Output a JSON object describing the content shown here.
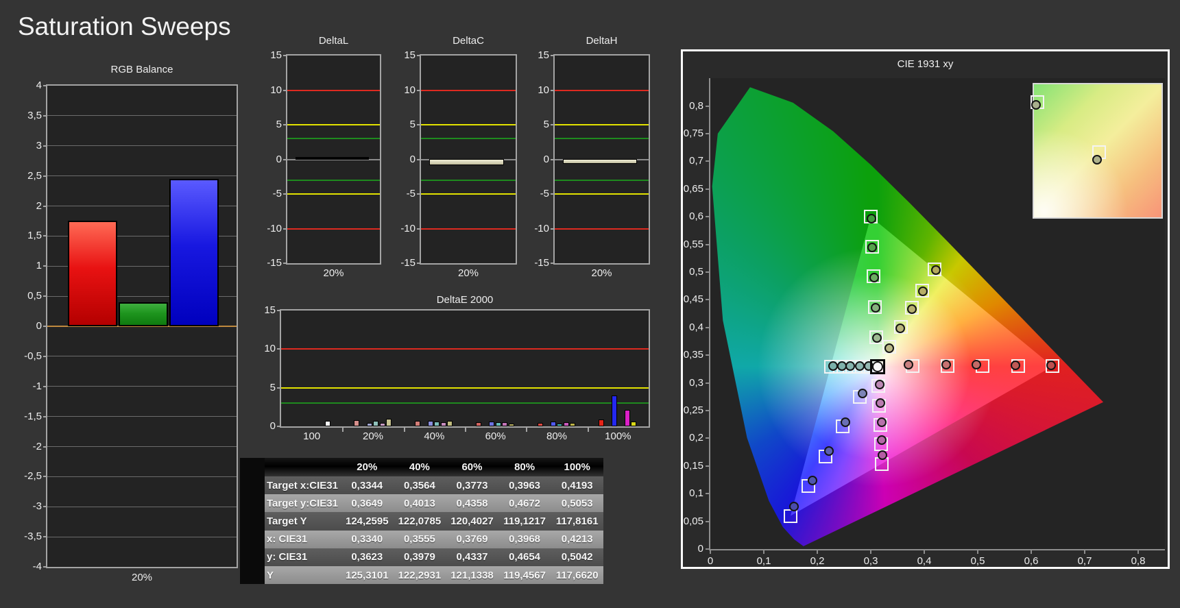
{
  "page": {
    "title": "Saturation Sweeps"
  },
  "colors": {
    "limit_red": "#DE2A20",
    "limit_yellow": "#E2E200",
    "limit_green": "#1E8A1E",
    "zero_orange": "#C08A3E",
    "zero_gray": "#8C8C8C",
    "white_bar": "#F4F4F4"
  },
  "chart_data": [
    {
      "id": "rgb_balance",
      "type": "bar",
      "title": "RGB Balance",
      "xlabel": "20%",
      "categories": [
        "Red",
        "Green",
        "Blue"
      ],
      "values": [
        1.75,
        0.4,
        2.45
      ],
      "ylim": [
        -4,
        4
      ],
      "ytick_step": 0.5,
      "grid": true,
      "bar_gradients": [
        [
          "#FF6A55",
          "#E81212",
          "#B40000"
        ],
        [
          "#3FAF3F",
          "#1E951E",
          "#0F7A0F"
        ],
        [
          "#5A5AFF",
          "#1818E0",
          "#0000BE"
        ]
      ]
    },
    {
      "id": "deltaL",
      "type": "bar",
      "title": "DeltaL",
      "xlabel": "20%",
      "categories": [
        "20%"
      ],
      "values": [
        0.3
      ],
      "ylim": [
        -15,
        15
      ],
      "yticks": [
        15,
        10,
        5,
        0,
        -5,
        -10,
        -15
      ],
      "limits": {
        "red": 10,
        "yellow": 5,
        "green": 3
      },
      "bar_color_top": "#0A0A0A",
      "bar_color_bottom": "#000000"
    },
    {
      "id": "deltaC",
      "type": "bar",
      "title": "DeltaC",
      "xlabel": "20%",
      "categories": [
        "20%"
      ],
      "values": [
        -0.95
      ],
      "ylim": [
        -15,
        15
      ],
      "yticks": [
        15,
        10,
        5,
        0,
        -5,
        -10,
        -15
      ],
      "limits": {
        "red": 10,
        "yellow": 5,
        "green": 3
      },
      "bar_color_top": "#EFEDD6",
      "bar_color_bottom": "#C2BE9E"
    },
    {
      "id": "deltaH",
      "type": "bar",
      "title": "DeltaH",
      "xlabel": "20%",
      "categories": [
        "20%"
      ],
      "values": [
        -0.7
      ],
      "ylim": [
        -15,
        15
      ],
      "yticks": [
        15,
        10,
        5,
        0,
        -5,
        -10,
        -15
      ],
      "limits": {
        "red": 10,
        "yellow": 5,
        "green": 3
      },
      "bar_color_top": "#EFEDD6",
      "bar_color_bottom": "#C2BE9E"
    },
    {
      "id": "deltaE2000",
      "type": "grouped-bar",
      "title": "DeltaE 2000",
      "ylim": [
        0,
        15
      ],
      "yticks": [
        0,
        5,
        10,
        15
      ],
      "limits": {
        "red": 10,
        "yellow": 5,
        "green": 3
      },
      "groups": [
        {
          "label": "100",
          "bars": [
            {
              "slot": 5,
              "value": 0.7,
              "color": "#F4F4F4"
            }
          ]
        },
        {
          "label": "20%",
          "bars": [
            {
              "slot": 0,
              "value": 0.8,
              "color": "#D6908C"
            },
            {
              "slot": 2,
              "value": 0.45,
              "color": "#A2A8D2"
            },
            {
              "slot": 3,
              "value": 0.75,
              "color": "#8FC0BA"
            },
            {
              "slot": 4,
              "value": 0.45,
              "color": "#C89CC2"
            },
            {
              "slot": 5,
              "value": 0.95,
              "color": "#C6C290"
            }
          ]
        },
        {
          "label": "40%",
          "bars": [
            {
              "slot": 0,
              "value": 0.75,
              "color": "#D47E78"
            },
            {
              "slot": 2,
              "value": 0.7,
              "color": "#8A8EDC"
            },
            {
              "slot": 3,
              "value": 0.65,
              "color": "#7CBEB8"
            },
            {
              "slot": 4,
              "value": 0.5,
              "color": "#C68CBE"
            },
            {
              "slot": 5,
              "value": 0.7,
              "color": "#C0BC7E"
            }
          ]
        },
        {
          "label": "60%",
          "bars": [
            {
              "slot": 0,
              "value": 0.55,
              "color": "#D26460"
            },
            {
              "slot": 2,
              "value": 0.6,
              "color": "#6C72E2"
            },
            {
              "slot": 3,
              "value": 0.5,
              "color": "#64BCB6"
            },
            {
              "slot": 4,
              "value": 0.5,
              "color": "#C474B8"
            },
            {
              "slot": 5,
              "value": 0.35,
              "color": "#BCB464"
            }
          ]
        },
        {
          "label": "80%",
          "bars": [
            {
              "slot": 0,
              "value": 0.45,
              "color": "#DA4840"
            },
            {
              "slot": 2,
              "value": 0.6,
              "color": "#5058EC"
            },
            {
              "slot": 3,
              "value": 0.35,
              "color": "#48BCB6"
            },
            {
              "slot": 4,
              "value": 0.5,
              "color": "#CA58BC"
            },
            {
              "slot": 5,
              "value": 0.4,
              "color": "#BCB448"
            }
          ]
        },
        {
          "label": "100%",
          "bars": [
            {
              "slot": 0,
              "value": 0.9,
              "color": "#E62418"
            },
            {
              "slot": 2,
              "value": 4.0,
              "color": "#2428F0"
            },
            {
              "slot": 4,
              "value": 2.1,
              "color": "#DC20C8"
            },
            {
              "slot": 5,
              "value": 0.65,
              "color": "#D8D818"
            }
          ]
        }
      ]
    },
    {
      "id": "sweep_table",
      "type": "table",
      "columns": [
        "20%",
        "40%",
        "60%",
        "80%",
        "100%"
      ],
      "rows": [
        {
          "label": "Target x:CIE31",
          "values": [
            "0,3344",
            "0,3564",
            "0,3773",
            "0,3963",
            "0,4193"
          ]
        },
        {
          "label": "Target y:CIE31",
          "values": [
            "0,3649",
            "0,4013",
            "0,4358",
            "0,4672",
            "0,5053"
          ]
        },
        {
          "label": "Target Y",
          "values": [
            "124,2595",
            "122,0785",
            "120,4027",
            "119,1217",
            "117,8161"
          ]
        },
        {
          "label": "x: CIE31",
          "values": [
            "0,3340",
            "0,3555",
            "0,3769",
            "0,3968",
            "0,4213"
          ]
        },
        {
          "label": "y: CIE31",
          "values": [
            "0,3623",
            "0,3979",
            "0,4337",
            "0,4654",
            "0,5042"
          ]
        },
        {
          "label": "Y",
          "values": [
            "125,3101",
            "122,2931",
            "121,1338",
            "119,4567",
            "117,6620"
          ]
        }
      ]
    },
    {
      "id": "cie1931",
      "type": "scatter",
      "title": "CIE 1931 xy",
      "xlim": [
        0,
        0.85
      ],
      "ylim": [
        0,
        0.85
      ],
      "xtick_step": 0.1,
      "ytick_step": 0.05,
      "locus": [
        [
          0.1741,
          0.005
        ],
        [
          0.1566,
          0.0177
        ],
        [
          0.1355,
          0.0399
        ],
        [
          0.1096,
          0.0868
        ],
        [
          0.0687,
          0.2007
        ],
        [
          0.0235,
          0.4127
        ],
        [
          0.0034,
          0.6548
        ],
        [
          0.0139,
          0.7502
        ],
        [
          0.0743,
          0.8338
        ],
        [
          0.1547,
          0.8059
        ],
        [
          0.2296,
          0.7543
        ],
        [
          0.3016,
          0.6923
        ],
        [
          0.3731,
          0.6245
        ],
        [
          0.4441,
          0.5547
        ],
        [
          0.5125,
          0.4866
        ],
        [
          0.5752,
          0.4242
        ],
        [
          0.627,
          0.3725
        ],
        [
          0.6658,
          0.334
        ],
        [
          0.6915,
          0.3083
        ],
        [
          0.719,
          0.2809
        ],
        [
          0.7347,
          0.2653
        ]
      ],
      "triangle": {
        "red": [
          0.64,
          0.33
        ],
        "green": [
          0.3,
          0.6
        ],
        "blue": [
          0.15,
          0.06
        ]
      },
      "white_point": {
        "target": [
          0.3127,
          0.329
        ],
        "measured": [
          0.3127,
          0.3295
        ],
        "dot_color": "#F8F8F8"
      },
      "sweeps": [
        {
          "name": "red",
          "targets": [
            [
              0.378,
              0.331
            ],
            [
              0.444,
              0.331
            ],
            [
              0.509,
              0.33
            ],
            [
              0.575,
              0.33
            ],
            [
              0.64,
              0.33
            ]
          ],
          "measured": [
            [
              0.37,
              0.333
            ],
            [
              0.441,
              0.333
            ],
            [
              0.497,
              0.333
            ],
            [
              0.571,
              0.332
            ],
            [
              0.637,
              0.332
            ]
          ],
          "dot_colors": [
            "#C98080",
            "#C97272",
            "#C46A66",
            "#C05A56",
            "#BE5050"
          ]
        },
        {
          "name": "green",
          "targets": [
            [
              0.31,
              0.383
            ],
            [
              0.308,
              0.437
            ],
            [
              0.305,
              0.492
            ],
            [
              0.303,
              0.546
            ],
            [
              0.3,
              0.6
            ]
          ],
          "measured": [
            [
              0.311,
              0.381
            ],
            [
              0.309,
              0.436
            ],
            [
              0.306,
              0.49
            ],
            [
              0.303,
              0.544
            ],
            [
              0.301,
              0.597
            ]
          ],
          "dot_colors": [
            "#9DBA92",
            "#85B27C",
            "#6CAC60",
            "#55A24C",
            "#3F9E3C"
          ]
        },
        {
          "name": "blue",
          "targets": [
            [
              0.28,
              0.275
            ],
            [
              0.248,
              0.221
            ],
            [
              0.215,
              0.167
            ],
            [
              0.183,
              0.114
            ],
            [
              0.15,
              0.06
            ]
          ],
          "measured": [
            [
              0.284,
              0.281
            ],
            [
              0.253,
              0.229
            ],
            [
              0.222,
              0.177
            ],
            [
              0.191,
              0.124
            ],
            [
              0.157,
              0.077
            ]
          ],
          "dot_colors": [
            "#7C84B6",
            "#6A6FB4",
            "#5C60B2",
            "#5056AE",
            "#4A4CAC"
          ]
        },
        {
          "name": "cyan",
          "targets": [
            [
              0.295,
              0.329
            ],
            [
              0.277,
              0.329
            ],
            [
              0.26,
              0.329
            ],
            [
              0.242,
              0.329
            ],
            [
              0.225,
              0.329
            ]
          ],
          "measured": [
            [
              0.296,
              0.33
            ],
            [
              0.279,
              0.331
            ],
            [
              0.262,
              0.331
            ],
            [
              0.246,
              0.331
            ],
            [
              0.229,
              0.331
            ]
          ],
          "dot_colors": [
            "#95B8B2",
            "#8CB6B0",
            "#86B4AE",
            "#80B2AC",
            "#7AB0AA"
          ]
        },
        {
          "name": "magenta",
          "targets": [
            [
              0.314,
              0.294
            ],
            [
              0.316,
              0.259
            ],
            [
              0.318,
              0.224
            ],
            [
              0.319,
              0.189
            ],
            [
              0.321,
              0.154
            ]
          ],
          "measured": [
            [
              0.317,
              0.297
            ],
            [
              0.318,
              0.263
            ],
            [
              0.32,
              0.229
            ],
            [
              0.321,
              0.197
            ],
            [
              0.322,
              0.17
            ]
          ],
          "dot_colors": [
            "#BC88B4",
            "#BA7CB0",
            "#B871AC",
            "#B667A8",
            "#B45CA4"
          ]
        },
        {
          "name": "yellow",
          "targets": [
            [
              0.3344,
              0.3649
            ],
            [
              0.3564,
              0.4013
            ],
            [
              0.3773,
              0.4358
            ],
            [
              0.3963,
              0.4672
            ],
            [
              0.4193,
              0.5053
            ]
          ],
          "measured": [
            [
              0.334,
              0.3623
            ],
            [
              0.3555,
              0.3979
            ],
            [
              0.3769,
              0.4337
            ],
            [
              0.3968,
              0.4654
            ],
            [
              0.4213,
              0.5042
            ]
          ],
          "dot_colors": [
            "#BCBA88",
            "#BAB67C",
            "#B8B270",
            "#B6AE66",
            "#B4AA5C"
          ]
        }
      ],
      "inset": {
        "markers": [
          {
            "square": [
              5,
              26
            ],
            "circle": [
              3,
              30
            ],
            "dot_color": "#A8AE8C"
          },
          {
            "square": [
              95,
              99
            ],
            "circle": [
              92,
              110
            ],
            "dot_color": "#AEB28A"
          }
        ]
      }
    }
  ]
}
